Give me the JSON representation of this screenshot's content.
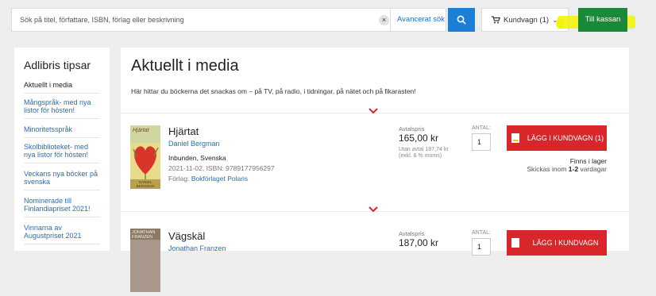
{
  "search": {
    "placeholder": "Sök på titel, författare, ISBN, förlag eller beskrivning",
    "clear_icon": "close-icon",
    "advanced_label": "Avancerat sök",
    "button_icon": "search-icon"
  },
  "cart": {
    "label": "Kundvagn (1)",
    "icon": "cart-icon"
  },
  "checkout": {
    "label": "Till kassan"
  },
  "sidebar": {
    "title": "Adlibris tipsar",
    "items": [
      "Aktuellt i media",
      "Mångspråk- med nya listor för hösten!",
      "Minoritetsspråk",
      "Skolbiblioteket- med nya listor för hösten!",
      "Veckans nya böcker på svenska",
      "Nominerade till Finlandiapriset 2021!",
      "Vinnarna av Augustpriset 2021"
    ]
  },
  "main": {
    "title": "Aktuellt i media",
    "intro": "Här hittar du böckerna det snackas om – på TV, på radio, i tidningar, på nätet och på fikarasten!"
  },
  "products": [
    {
      "title": "Hjärtat",
      "author": "Daniel Bergman",
      "cover_title": "Hjärtat",
      "cover_author": "DANIEL BERGMAN",
      "format": "Inbunden, Svenska",
      "meta": "2021-11-02, ISBN: 9789177956297",
      "publisher_prefix": "Förlag: ",
      "publisher": "Bokförlaget Polaris",
      "price_label": "Avtalspris",
      "price": "165,00 kr",
      "price_note": "Utan avtal 187,74 kr (exkl. 6 % moms)",
      "qty_label": "ANTAL:",
      "qty": "1",
      "button": "LÄGG I KUNDVAGN (1)",
      "stock": "Finns i lager",
      "ship_prefix": "Skickas inom ",
      "ship_days": "1-2",
      "ship_suffix": " vardagar"
    },
    {
      "title": "Vägskäl",
      "author": "Jonathan Franzen",
      "cover_title": "JONATHAN FRANZEN",
      "price_label": "Avtalspris",
      "price": "187,00 kr",
      "qty_label": "ANTAL:",
      "qty": "1",
      "button": "LÄGG I KUNDVAGN"
    }
  ],
  "colors": {
    "accent_blue": "#1c7fd6",
    "checkout_green": "#1a8a38",
    "buy_red": "#d9262b",
    "highlight": "#f1f300"
  }
}
